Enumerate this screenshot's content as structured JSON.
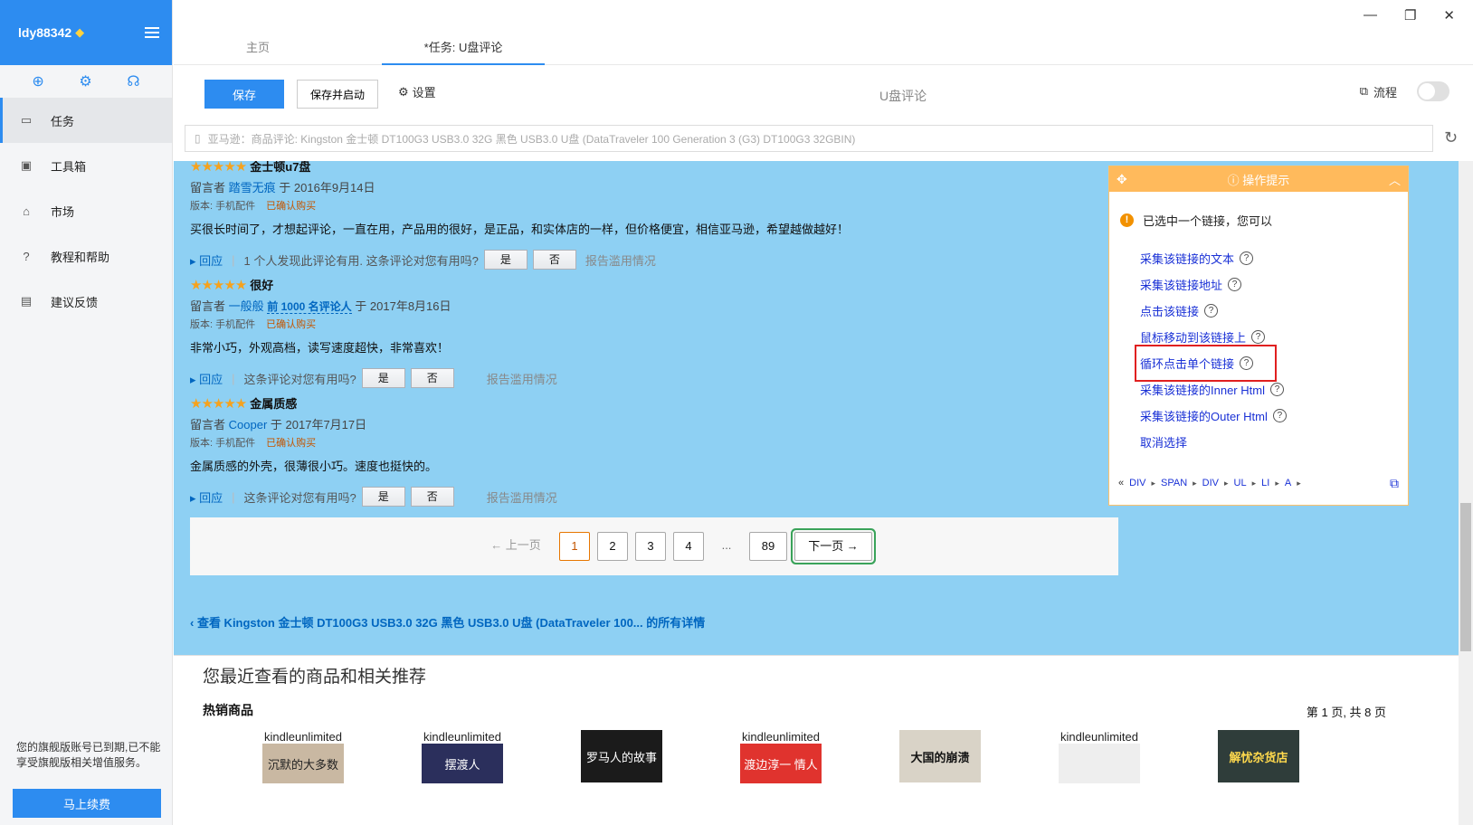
{
  "sidebar": {
    "username": "ldy88342",
    "nav": [
      {
        "label": "任务",
        "icon": "document-icon"
      },
      {
        "label": "工具箱",
        "icon": "toolbox-icon"
      },
      {
        "label": "市场",
        "icon": "lock-icon"
      },
      {
        "label": "教程和帮助",
        "icon": "help-icon"
      },
      {
        "label": "建议反馈",
        "icon": "chat-icon"
      }
    ],
    "notice": "您的旗舰版账号已到期,已不能享受旗舰版相关增值服务。",
    "renew_label": "马上续费"
  },
  "tabs": [
    {
      "label": "主页"
    },
    {
      "label": "*任务: U盘评论"
    }
  ],
  "toolbar": {
    "save_label": "保存",
    "save_start_label": "保存并启动",
    "settings_label": "设置",
    "task_title": "U盘评论",
    "flow_label": "流程"
  },
  "url": {
    "text": "亚马逊：商品评论: Kingston 金士顿 DT100G3 USB3.0 32G 黑色 USB3.0 U盘 (DataTraveler 100 Generation 3 (G3) DT100G3 32GBIN)"
  },
  "reviews": [
    {
      "stars": "★★★★★",
      "title": "金士顿u7盘",
      "prefix": "留言者",
      "author": "踏雪无痕",
      "badge": "",
      "date": "于 2016年9月14日",
      "format": "版本: 手机配件",
      "verified": "已确认购买",
      "body": "买很长时间了，才想起评论，一直在用，产品用的很好，是正品，和实体店的一样，但价格便宜，相信亚马逊，希望越做越好！",
      "reply": "回应",
      "helpful": "1 个人发现此评论有用. 这条评论对您有用吗?",
      "yes": "是",
      "no": "否",
      "report": "报告滥用情况"
    },
    {
      "stars": "★★★★★",
      "title": "很好",
      "prefix": "留言者",
      "author": "一般般",
      "badge": "前 1000 名评论人",
      "date": "于 2017年8月16日",
      "format": "版本: 手机配件",
      "verified": "已确认购买",
      "body": "非常小巧，外观高档，读写速度超快，非常喜欢！",
      "reply": "回应",
      "helpful": "这条评论对您有用吗?",
      "yes": "是",
      "no": "否",
      "report": "报告滥用情况"
    },
    {
      "stars": "★★★★★",
      "title": "金属质感",
      "prefix": "留言者",
      "author": "Cooper",
      "badge": "",
      "date": "于 2017年7月17日",
      "format": "版本: 手机配件",
      "verified": "已确认购买",
      "body": "金属质感的外壳，很薄很小巧。速度也挺快的。",
      "reply": "回应",
      "helpful": "这条评论对您有用吗?",
      "yes": "是",
      "no": "否",
      "report": "报告滥用情况"
    }
  ],
  "pager": {
    "prev": "← 上一页",
    "pages": [
      "1",
      "2",
      "3",
      "4"
    ],
    "dots": "...",
    "last": "89",
    "next": "下一页 →"
  },
  "all_details": "‹ 查看 Kingston 金士顿 DT100G3 USB3.0 32G 黑色 USB3.0 U盘 (DataTraveler 100... 的所有详情",
  "recent": {
    "title": "您最近查看的商品和相关推荐",
    "hot": "热销商品",
    "page_info": "第 1 页, 共 8 页",
    "books": [
      {
        "ku": "kindleunlimited",
        "text": "沉默的大多数",
        "color": "#c9b8a2"
      },
      {
        "ku": "kindleunlimited",
        "text": "摆渡人",
        "color": "#2b2f5c"
      },
      {
        "ku": "",
        "text": "罗马人的故事",
        "color": "#1b1b1b"
      },
      {
        "ku": "kindleunlimited",
        "text": "渡边淳一 情人",
        "color": "#e0332e"
      },
      {
        "ku": "",
        "text": "大国的崩溃",
        "color": "#d9d3c7"
      },
      {
        "ku": "kindleunlimited",
        "text": "",
        "color": "#eeeeee"
      },
      {
        "ku": "",
        "text": "解忧杂货店",
        "color": "#2f3d3a"
      }
    ]
  },
  "tip": {
    "header": "操作提示",
    "message": "已选中一个链接，您可以",
    "links": [
      "采集该链接的文本",
      "采集该链接地址",
      "点击该链接",
      "鼠标移动到该链接上",
      "循环点击单个链接",
      "采集该链接的Inner Html",
      "采集该链接的Outer Html",
      "取消选择"
    ],
    "crumbs": [
      "DIV",
      "SPAN",
      "DIV",
      "UL",
      "LI",
      "A"
    ]
  },
  "colors": {
    "accent": "#2d8cf0",
    "highlight": "#8ed0f3",
    "tip_header": "#ffba5c"
  }
}
